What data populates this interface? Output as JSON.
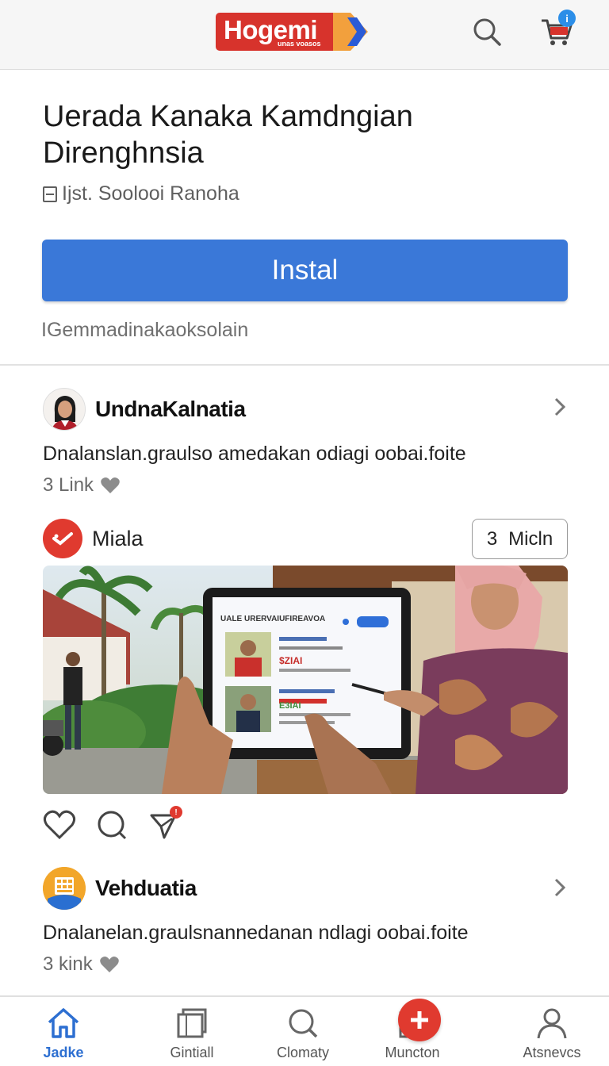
{
  "header": {
    "logo_text": "Hogemi",
    "logo_subtext": "unas voasos",
    "cart_badge": "i"
  },
  "app": {
    "title": "Uerada Kanaka Kamdngian Direnghnsia",
    "developer": "Ijst. Soolooi Ranoha",
    "install_label": "Instal",
    "note": "IGemmadinakaoksolain"
  },
  "posts": [
    {
      "name": "UndnaKalnatia",
      "text": "Dnalanslan.graulso amedakan odiagi oobai.foite",
      "meta": "3 Link"
    },
    {
      "name": "Vehduatia",
      "text": "Dnalanelan.graulsnannedanan ndlagi oobai.foite",
      "meta": "3 kink"
    }
  ],
  "media_post": {
    "source": "Miala",
    "count_number": "3",
    "count_label": "Micln",
    "screen_header": "UALE URERVAIUFIREAVOA",
    "screen_lines": [
      "$ZIAI",
      "E3IAI"
    ]
  },
  "nav": {
    "items": [
      {
        "label": "Jadke"
      },
      {
        "label": "Gintiall"
      },
      {
        "label": "Clomaty"
      },
      {
        "label": "Muncton"
      },
      {
        "label": "Atsnevcs"
      }
    ]
  },
  "colors": {
    "accent": "#3a78d8",
    "brand": "#d7332c",
    "fab": "#e03a2f"
  }
}
